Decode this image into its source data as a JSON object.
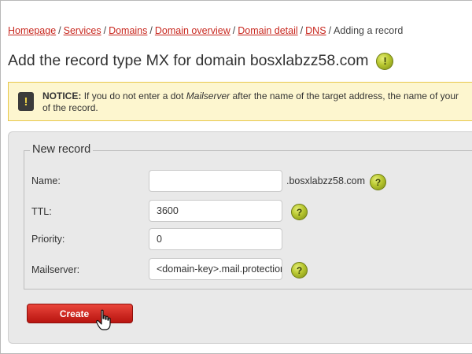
{
  "breadcrumb": {
    "items": [
      "Homepage",
      "Services",
      "Domains",
      "Domain overview",
      "Domain detail",
      "DNS"
    ],
    "current": "Adding a record",
    "separator": "/"
  },
  "page": {
    "title": "Add the record type MX for domain bosxlabzz58.com",
    "info_icon": "!"
  },
  "notice": {
    "icon": "!",
    "label": "NOTICE:",
    "text_before": "If you do not enter a dot",
    "text_italic": "Mailserver",
    "text_after": "after the name of the target address, the name of your",
    "text_line2": "of the record."
  },
  "form": {
    "legend": "New record",
    "fields": {
      "name": {
        "label": "Name:",
        "value": "",
        "suffix": ".bosxlabzz58.com",
        "help": "?"
      },
      "ttl": {
        "label": "TTL:",
        "value": "3600",
        "help": "?"
      },
      "priority": {
        "label": "Priority:",
        "value": "0"
      },
      "mailserver": {
        "label": "Mailserver:",
        "value": "<domain-key>.mail.protection",
        "help": "?"
      }
    },
    "create_label": "Create"
  },
  "colors": {
    "link": "#c8281f",
    "notice_bg": "#fdf6cf",
    "notice_border": "#e8c84b",
    "button": "#d12a22",
    "help_icon": "#b7c62f"
  }
}
